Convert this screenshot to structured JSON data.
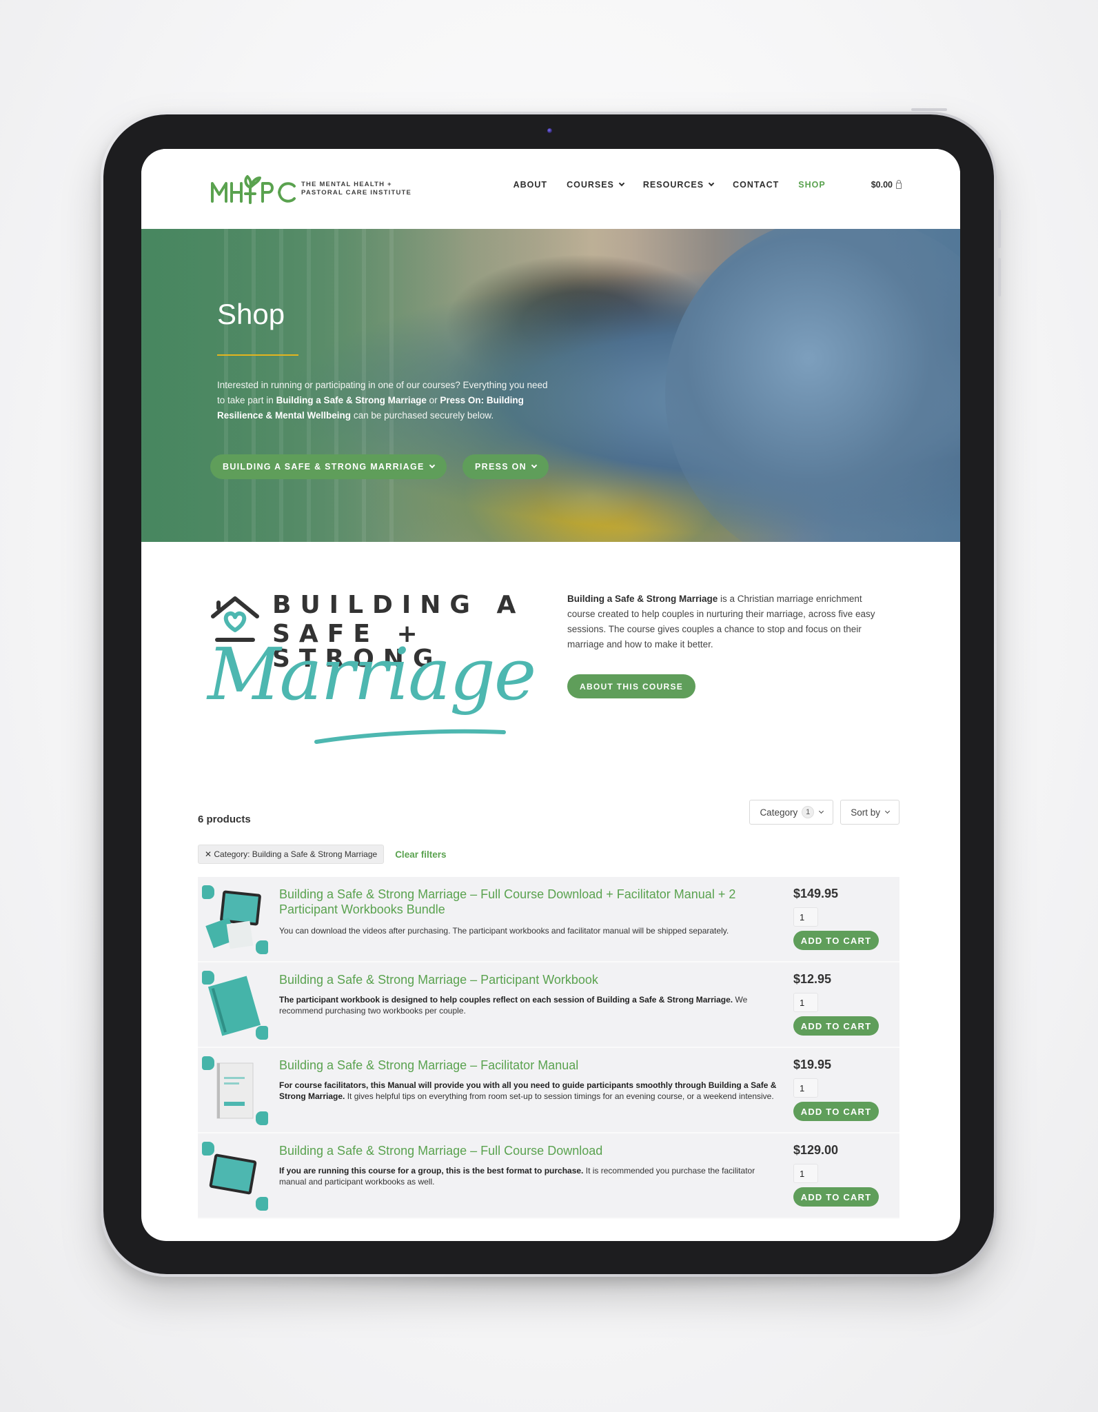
{
  "header": {
    "logo_mark": "MH+PC",
    "logo_line1": "THE MENTAL HEALTH +",
    "logo_line2": "PASTORAL CARE INSTITUTE",
    "nav": [
      {
        "label": "ABOUT",
        "dropdown": false,
        "active": false
      },
      {
        "label": "COURSES",
        "dropdown": true,
        "active": false
      },
      {
        "label": "RESOURCES",
        "dropdown": true,
        "active": false
      },
      {
        "label": "CONTACT",
        "dropdown": false,
        "active": false
      },
      {
        "label": "SHOP",
        "dropdown": false,
        "active": true
      }
    ],
    "cart_total": "$0.00",
    "cart_icon": "shopping-bag-icon"
  },
  "hero": {
    "title": "Shop",
    "text_part1": "Interested in running or participating in one of our courses? Everything you need to take part in ",
    "text_bold1": "Building a Safe & Strong Marriage",
    "text_part2": " or ",
    "text_bold2": "Press On: Building Resilience & Mental Wellbeing",
    "text_part3": " can be purchased securely below.",
    "buttons": [
      {
        "label": "BUILDING A SAFE & STRONG MARRIAGE"
      },
      {
        "label": "PRESS ON"
      }
    ]
  },
  "course": {
    "logo_line1": "BUILDING A",
    "logo_line2": "SAFE + STRONG",
    "logo_script": "Marriage",
    "desc_bold": "Building a Safe & Strong Marriage",
    "desc_rest": " is a Christian marriage enrichment course created to help couples in nurturing their marriage, across five easy sessions. The course gives couples a chance to stop and focus on their marriage and how to make it better.",
    "button_label": "ABOUT THIS COURSE"
  },
  "shop": {
    "product_count": "6 products",
    "category_label": "Category",
    "category_count": "1",
    "sort_label": "Sort by",
    "active_filter": "Category: Building a Safe & Strong Marriage",
    "clear_filters": "Clear filters",
    "add_to_cart_label": "ADD TO CART",
    "products": [
      {
        "title": "Building a Safe & Strong Marriage – Full Course Download + Facilitator Manual + 2 Participant Workbooks Bundle",
        "desc_bold": "",
        "desc_rest": "You can download the videos after purchasing. The participant workbooks and facilitator manual will be shipped separately.",
        "price": "$149.95",
        "qty": "1",
        "thumb": "bundle"
      },
      {
        "title": "Building a Safe & Strong Marriage – Participant Workbook",
        "desc_bold": "The participant workbook is designed to help couples reflect on each session of Building a Safe & Strong Marriage.",
        "desc_rest": " We recommend purchasing two workbooks per couple.",
        "price": "$12.95",
        "qty": "1",
        "thumb": "workbook"
      },
      {
        "title": "Building a Safe & Strong Marriage – Facilitator Manual",
        "desc_bold": "For course facilitators, this Manual will provide you with all you need to guide participants smoothly through Building a Safe & Strong Marriage.",
        "desc_rest": " It gives helpful tips on everything from room set-up to session timings for an evening course, or a weekend intensive.",
        "price": "$19.95",
        "qty": "1",
        "thumb": "manual"
      },
      {
        "title": "Building a Safe & Strong Marriage – Full Course Download",
        "desc_bold": "If you are running this course for a group, this is the best format to purchase.",
        "desc_rest": " It is recommended you purchase the facilitator manual and participant workbooks as well.",
        "price": "$129.00",
        "qty": "1",
        "thumb": "download"
      }
    ]
  },
  "colors": {
    "brand_green": "#5aa24f",
    "button_green": "#5f9e5a",
    "teal": "#4db7b0",
    "accent_yellow": "#e4b51e",
    "bezel": "#1d1d1f"
  }
}
